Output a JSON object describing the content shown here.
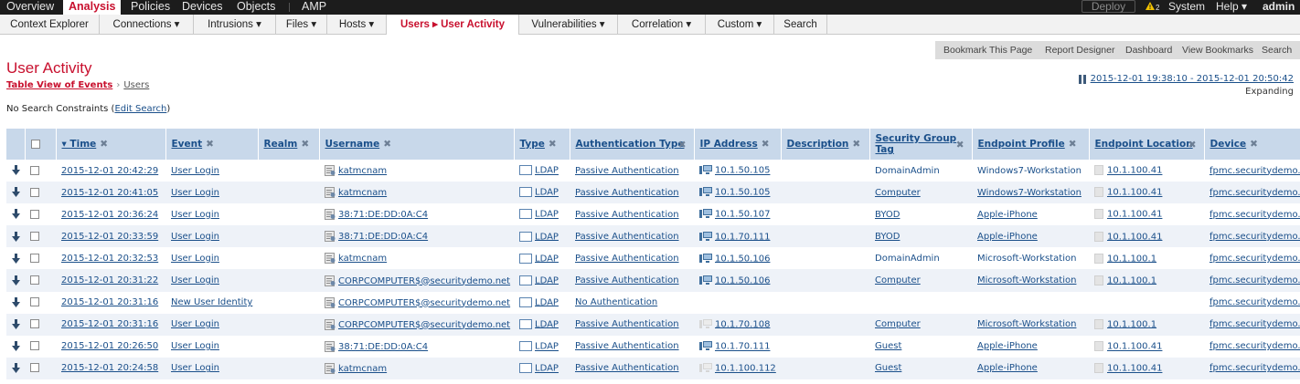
{
  "topnav": {
    "items": [
      "Overview",
      "Analysis",
      "Policies",
      "Devices",
      "Objects",
      "AMP"
    ],
    "active": "Analysis",
    "deploy_label": "Deploy",
    "warn_count": "2",
    "system_label": "System",
    "help_label": "Help ▾",
    "admin_label": "admin"
  },
  "subnav": {
    "tabs": [
      "Context Explorer",
      "Connections ▾",
      "Intrusions ▾",
      "Files ▾",
      "Hosts ▾",
      "Users ▸ User Activity",
      "Vulnerabilities ▾",
      "Correlation ▾",
      "Custom ▾",
      "Search"
    ],
    "active": "Users ▸ User Activity"
  },
  "bookmarks": [
    "Bookmark This Page",
    "Report Designer",
    "Dashboard",
    "View Bookmarks",
    "Search"
  ],
  "page": {
    "title": "User Activity",
    "breadcrumb_view": "Table View of Events",
    "breadcrumb_sep": "›",
    "breadcrumb_users": "Users",
    "time_range": "2015-12-01 19:38:10 - 2015-12-01 20:50:42",
    "expanding": "Expanding",
    "constraints_prefix": "No Search Constraints (",
    "constraints_link": "Edit Search",
    "constraints_suffix": ")"
  },
  "table": {
    "columns": [
      {
        "key": "time",
        "label": "▾ Time"
      },
      {
        "key": "event",
        "label": "Event"
      },
      {
        "key": "realm",
        "label": "Realm"
      },
      {
        "key": "username",
        "label": "Username"
      },
      {
        "key": "type",
        "label": "Type"
      },
      {
        "key": "auth",
        "label": "Authentication Type"
      },
      {
        "key": "ip",
        "label": "IP Address"
      },
      {
        "key": "desc",
        "label": "Description"
      },
      {
        "key": "sgt",
        "label": "Security Group Tag"
      },
      {
        "key": "profile",
        "label": "Endpoint Profile"
      },
      {
        "key": "location",
        "label": "Endpoint Location"
      },
      {
        "key": "device",
        "label": "Device"
      }
    ],
    "rows": [
      {
        "time": "2015-12-01 20:42:29",
        "event": "User Login",
        "realm": "",
        "username": "katmcnam",
        "type": "LDAP",
        "auth": "Passive Authentication",
        "ip": "10.1.50.105",
        "ip_icon": "host",
        "desc": "",
        "sgt": "DomainAdmin",
        "sgt_link": false,
        "profile": "Windows7-Workstation",
        "profile_link": false,
        "location": "10.1.100.41",
        "device": "fpmc.securitydemo.net"
      },
      {
        "time": "2015-12-01 20:41:05",
        "event": "User Login",
        "realm": "",
        "username": "katmcnam",
        "type": "LDAP",
        "auth": "Passive Authentication",
        "ip": "10.1.50.105",
        "ip_icon": "host",
        "desc": "",
        "sgt": "Computer",
        "sgt_link": true,
        "profile": "Windows7-Workstation",
        "profile_link": true,
        "location": "10.1.100.41",
        "device": "fpmc.securitydemo.net"
      },
      {
        "time": "2015-12-01 20:36:24",
        "event": "User Login",
        "realm": "",
        "username": "38:71:DE:DD:0A:C4",
        "type": "LDAP",
        "auth": "Passive Authentication",
        "ip": "10.1.50.107",
        "ip_icon": "host",
        "desc": "",
        "sgt": "BYOD",
        "sgt_link": true,
        "profile": "Apple-iPhone",
        "profile_link": true,
        "location": "10.1.100.41",
        "device": "fpmc.securitydemo.net"
      },
      {
        "time": "2015-12-01 20:33:59",
        "event": "User Login",
        "realm": "",
        "username": "38:71:DE:DD:0A:C4",
        "type": "LDAP",
        "auth": "Passive Authentication",
        "ip": "10.1.70.111",
        "ip_icon": "host",
        "desc": "",
        "sgt": "BYOD",
        "sgt_link": true,
        "profile": "Apple-iPhone",
        "profile_link": true,
        "location": "10.1.100.41",
        "device": "fpmc.securitydemo.net"
      },
      {
        "time": "2015-12-01 20:32:53",
        "event": "User Login",
        "realm": "",
        "username": "katmcnam",
        "type": "LDAP",
        "auth": "Passive Authentication",
        "ip": "10.1.50.106",
        "ip_icon": "host",
        "desc": "",
        "sgt": "DomainAdmin",
        "sgt_link": false,
        "profile": "Microsoft-Workstation",
        "profile_link": false,
        "location": "10.1.100.1",
        "device": "fpmc.securitydemo.net"
      },
      {
        "time": "2015-12-01 20:31:22",
        "event": "User Login",
        "realm": "",
        "username": "CORPCOMPUTER$@securitydemo.net",
        "type": "LDAP",
        "auth": "Passive Authentication",
        "ip": "10.1.50.106",
        "ip_icon": "host",
        "desc": "",
        "sgt": "Computer",
        "sgt_link": true,
        "profile": "Microsoft-Workstation",
        "profile_link": true,
        "location": "10.1.100.1",
        "device": "fpmc.securitydemo.net"
      },
      {
        "time": "2015-12-01 20:31:16",
        "event": "New User Identity",
        "realm": "",
        "username": "CORPCOMPUTER$@securitydemo.net",
        "type": "LDAP",
        "auth": "No Authentication",
        "ip": "",
        "ip_icon": "",
        "desc": "",
        "sgt": "",
        "sgt_link": false,
        "profile": "",
        "profile_link": false,
        "location": "",
        "device": "fpmc.securitydemo.net"
      },
      {
        "time": "2015-12-01 20:31:16",
        "event": "User Login",
        "realm": "",
        "username": "CORPCOMPUTER$@securitydemo.net",
        "type": "LDAP",
        "auth": "Passive Authentication",
        "ip": "10.1.70.108",
        "ip_icon": "ghost",
        "desc": "",
        "sgt": "Computer",
        "sgt_link": true,
        "profile": "Microsoft-Workstation",
        "profile_link": true,
        "location": "10.1.100.1",
        "device": "fpmc.securitydemo.net"
      },
      {
        "time": "2015-12-01 20:26:50",
        "event": "User Login",
        "realm": "",
        "username": "38:71:DE:DD:0A:C4",
        "type": "LDAP",
        "auth": "Passive Authentication",
        "ip": "10.1.70.111",
        "ip_icon": "host",
        "desc": "",
        "sgt": "Guest",
        "sgt_link": true,
        "profile": "Apple-iPhone",
        "profile_link": true,
        "location": "10.1.100.41",
        "device": "fpmc.securitydemo.net"
      },
      {
        "time": "2015-12-01 20:24:58",
        "event": "User Login",
        "realm": "",
        "username": "katmcnam",
        "type": "LDAP",
        "auth": "Passive Authentication",
        "ip": "10.1.100.112",
        "ip_icon": "ghost",
        "desc": "",
        "sgt": "Guest",
        "sgt_link": true,
        "profile": "Apple-iPhone",
        "profile_link": true,
        "location": "10.1.100.41",
        "device": "fpmc.securitydemo.net"
      }
    ]
  },
  "colors": {
    "accent_red": "#c8102e",
    "link_blue": "#1a4f8a",
    "header_bg": "#c8d8ea",
    "nav_bg": "#1c1c1c"
  }
}
